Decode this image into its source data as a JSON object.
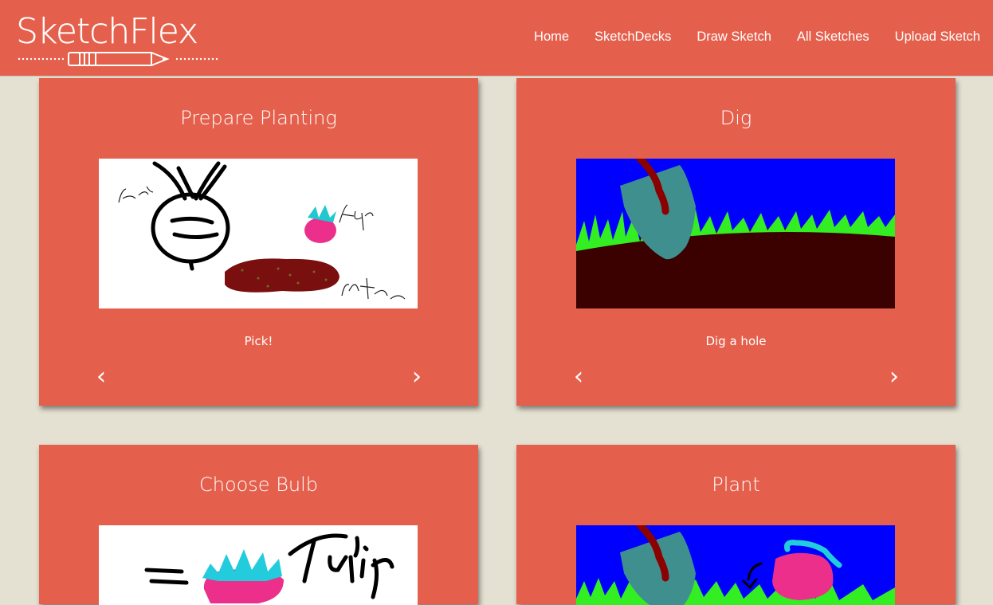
{
  "brand": {
    "name": "SketchFlex",
    "logo_icon": "pencil-icon"
  },
  "nav": {
    "items": [
      "Home",
      "SketchDecks",
      "Draw Sketch",
      "All Sketches",
      "Upload Sketch"
    ]
  },
  "cards": [
    {
      "title": "Prepare Planting",
      "caption": "Pick!",
      "prev": "‹",
      "next": "›",
      "sketch": {
        "labels": [
          "beet",
          "tulip",
          "potatoe"
        ]
      }
    },
    {
      "title": "Dig",
      "caption": "Dig a hole",
      "prev": "‹",
      "next": "›"
    },
    {
      "title": "Choose Bulb",
      "sketch": {
        "labels": [
          "Tulip"
        ]
      }
    },
    {
      "title": "Plant"
    }
  ],
  "colors": {
    "header": "#e5604c",
    "card": "#e5604c",
    "background": "#e4e0d2",
    "sky": "#0000ff",
    "grass": "#33ee22",
    "soil": "#3b0000"
  }
}
